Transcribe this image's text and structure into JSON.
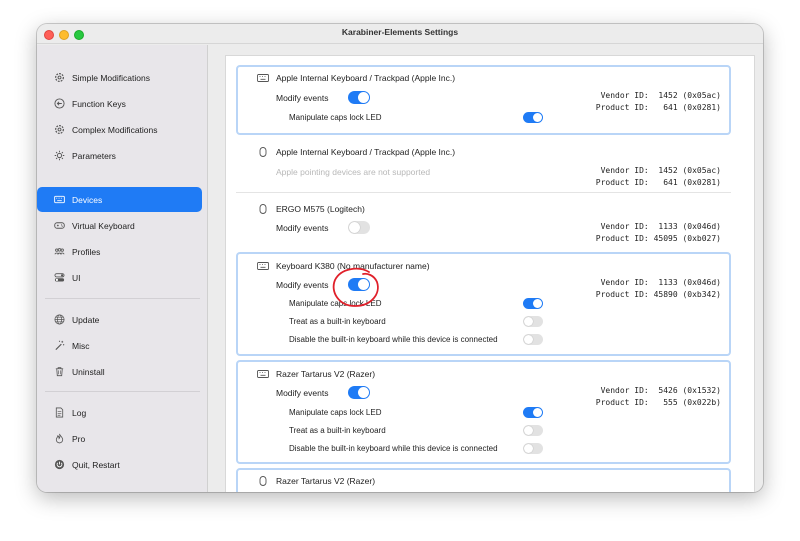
{
  "window": {
    "title": "Karabiner-Elements Settings"
  },
  "sidebar": {
    "items": [
      {
        "label": "Simple Modifications",
        "icon": "gear-icon"
      },
      {
        "label": "Function Keys",
        "icon": "circle-arrow-icon"
      },
      {
        "label": "Complex Modifications",
        "icon": "gear-icon"
      },
      {
        "label": "Parameters",
        "icon": "sun-icon"
      },
      {
        "label": "Devices",
        "icon": "keyboard-icon",
        "selected": true
      },
      {
        "label": "Virtual Keyboard",
        "icon": "gamepad-icon"
      },
      {
        "label": "Profiles",
        "icon": "people-icon"
      },
      {
        "label": "UI",
        "icon": "switches-icon"
      },
      {
        "label": "Update",
        "icon": "globe-icon"
      },
      {
        "label": "Misc",
        "icon": "wand-icon"
      },
      {
        "label": "Uninstall",
        "icon": "trash-icon"
      },
      {
        "label": "Log",
        "icon": "document-icon"
      },
      {
        "label": "Pro",
        "icon": "flame-icon"
      },
      {
        "label": "Quit, Restart",
        "icon": "power-icon"
      }
    ]
  },
  "labels": {
    "modify_events": "Modify events",
    "caps_lock_led": "Manipulate caps lock LED",
    "treat_builtin": "Treat as a built-in keyboard",
    "disable_builtin": "Disable the built-in keyboard while this device is connected",
    "not_supported": "Apple pointing devices are not supported"
  },
  "devices": [
    {
      "name": "Apple Internal Keyboard / Trackpad (Apple Inc.)",
      "icon": "keyboard-icon",
      "vendor": "Vendor ID:  1452 (0x05ac)",
      "product": "Product ID:   641 (0x0281)",
      "modify_events": true,
      "caps_lock_led": true
    },
    {
      "name": "Apple Internal Keyboard / Trackpad (Apple Inc.)",
      "icon": "mouse-icon",
      "vendor": "Vendor ID:  1452 (0x05ac)",
      "product": "Product ID:   641 (0x0281)"
    },
    {
      "name": "ERGO M575 (Logitech)",
      "icon": "mouse-icon",
      "vendor": "Vendor ID:  1133 (0x046d)",
      "product": "Product ID: 45095 (0xb027)",
      "modify_events": false
    },
    {
      "name": "Keyboard K380 (No manufacturer name)",
      "icon": "keyboard-icon",
      "vendor": "Vendor ID:  1133 (0x046d)",
      "product": "Product ID: 45890 (0xb342)",
      "modify_events": true,
      "caps_lock_led": true,
      "treat_builtin": false,
      "disable_builtin": false
    },
    {
      "name": "Razer Tartarus V2 (Razer)",
      "icon": "keyboard-icon",
      "vendor": "Vendor ID:  5426 (0x1532)",
      "product": "Product ID:   555 (0x022b)",
      "modify_events": true,
      "caps_lock_led": true,
      "treat_builtin": false,
      "disable_builtin": false
    },
    {
      "name": "Razer Tartarus V2 (Razer)",
      "icon": "mouse-icon"
    }
  ],
  "colors": {
    "accent": "#1f7bf5",
    "card_border": "#b9d5f7",
    "annotation": "#e0202a"
  }
}
